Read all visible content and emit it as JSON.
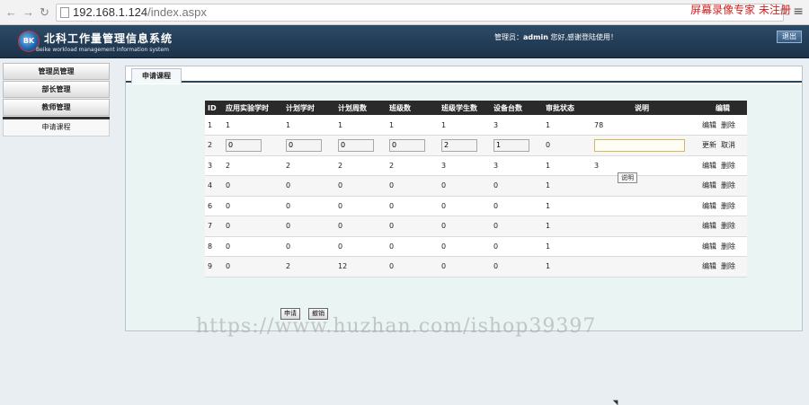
{
  "browser": {
    "back_glyph": "←",
    "forward_glyph": "→",
    "reload_glyph": "↻",
    "url_host": "192.168.1.124",
    "url_path": "/index.aspx",
    "overlay_text": "屏幕录像专家  未注册",
    "star_glyph": "☆",
    "menu_glyph": "≡"
  },
  "header": {
    "logo_text": "BK",
    "title": "北科工作量管理信息系统",
    "subtitle": "Beike workload management information system",
    "admin_prefix": "管理员：",
    "admin_name": "admin",
    "admin_suffix": " 您好,感谢登陆使用！",
    "logout_label": "退出"
  },
  "sidebar": {
    "items": [
      {
        "label": "管理员管理"
      },
      {
        "label": "部长管理"
      },
      {
        "label": "教师管理"
      }
    ],
    "sub_item": "申请课程"
  },
  "main": {
    "tab_label": "申请课程",
    "columns": [
      "ID",
      "应用实验学时",
      "计划学时",
      "计划周数",
      "班级数",
      "班级学生数",
      "设备台数",
      "审批状态",
      "说明",
      "编辑"
    ],
    "rows": [
      {
        "id": "1",
        "c1": "1",
        "c2": "1",
        "c3": "1",
        "c4": "1",
        "c5": "1",
        "c6": "3",
        "c7": "1",
        "c8": "78",
        "a1": "编辑",
        "a2": "删除"
      },
      {
        "id": "2",
        "c1": "0",
        "c2": "0",
        "c3": "0",
        "c4": "0",
        "c5": "2",
        "c6": "1",
        "c7": "0",
        "c8": "",
        "a1": "更新",
        "a2": "取消"
      },
      {
        "id": "3",
        "c1": "2",
        "c2": "2",
        "c3": "2",
        "c4": "2",
        "c5": "3",
        "c6": "3",
        "c7": "1",
        "c8": "3",
        "a1": "编辑",
        "a2": "删除"
      },
      {
        "id": "4",
        "c1": "0",
        "c2": "0",
        "c3": "0",
        "c4": "0",
        "c5": "0",
        "c6": "0",
        "c7": "1",
        "c8": "",
        "a1": "编辑",
        "a2": "删除"
      },
      {
        "id": "6",
        "c1": "0",
        "c2": "0",
        "c3": "0",
        "c4": "0",
        "c5": "0",
        "c6": "0",
        "c7": "1",
        "c8": "",
        "a1": "编辑",
        "a2": "删除"
      },
      {
        "id": "7",
        "c1": "0",
        "c2": "0",
        "c3": "0",
        "c4": "0",
        "c5": "0",
        "c6": "0",
        "c7": "1",
        "c8": "",
        "a1": "编辑",
        "a2": "删除"
      },
      {
        "id": "8",
        "c1": "0",
        "c2": "0",
        "c3": "0",
        "c4": "0",
        "c5": "0",
        "c6": "0",
        "c7": "1",
        "c8": "",
        "a1": "编辑",
        "a2": "删除"
      },
      {
        "id": "9",
        "c1": "0",
        "c2": "2",
        "c3": "12",
        "c4": "0",
        "c5": "0",
        "c6": "0",
        "c7": "1",
        "c8": "",
        "a1": "编辑",
        "a2": "删除"
      }
    ],
    "tooltip": "说明",
    "apply_button": "申请",
    "cancel_button": "撤销"
  },
  "watermark": "https://www.huzhan.com/ishop39397"
}
